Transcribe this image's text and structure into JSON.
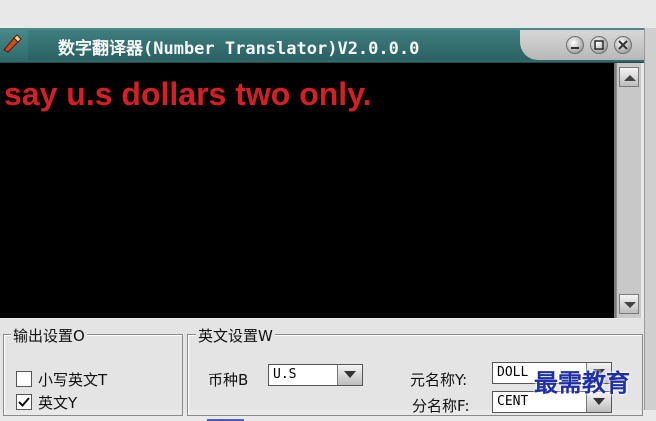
{
  "window": {
    "title": "数字翻译器(Number Translator)V2.0.0.0",
    "accent_color": "#2f6a6b",
    "icons": [
      "app-icon",
      "minimize-icon",
      "maximize-icon",
      "close-icon"
    ]
  },
  "output": {
    "text": "say u.s dollars two only.",
    "text_color": "#d61f25",
    "background": "#000000"
  },
  "output_settings": {
    "title": "输出设置O",
    "options": [
      {
        "label": "小写英文T",
        "checked": false
      },
      {
        "label": "英文Y",
        "checked": true
      }
    ]
  },
  "english_settings": {
    "title": "英文设置W",
    "currency_label": "币种B",
    "currency_value": "U.S",
    "yuan_label": "元名称Y:",
    "yuan_value": "DOLL",
    "fen_label": "分名称F:",
    "fen_value": "CENT"
  },
  "watermark": "最需教育"
}
